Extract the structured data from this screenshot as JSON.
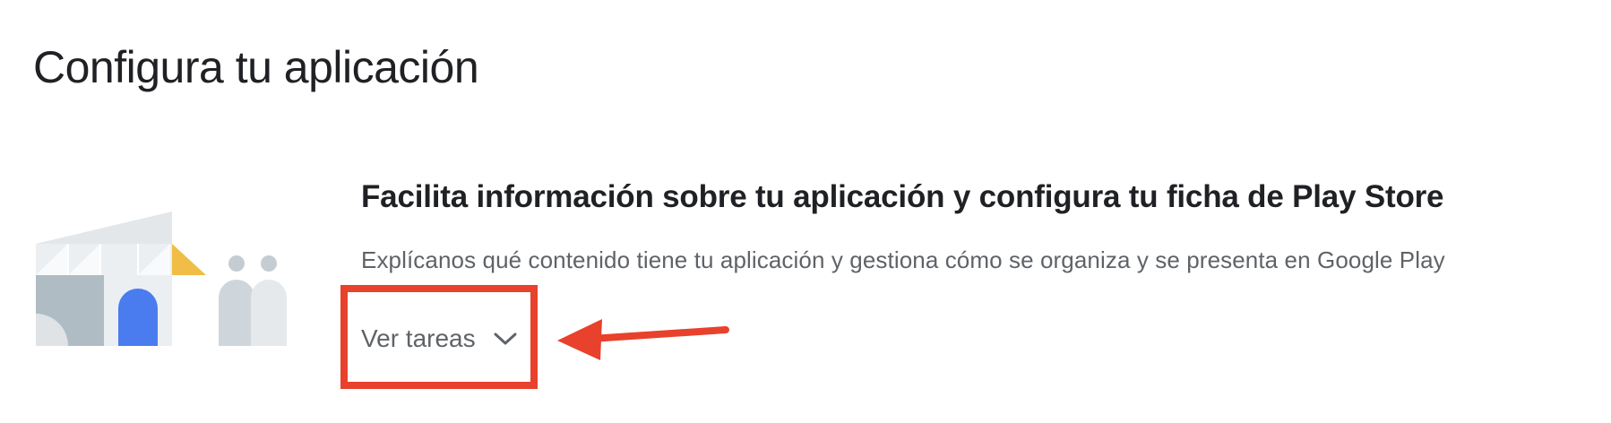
{
  "page": {
    "title": "Configura tu aplicación"
  },
  "section": {
    "title": "Facilita información sobre tu aplicación y configura tu ficha de Play Store",
    "description": "Explícanos qué contenido tiene tu aplicación y gestiona cómo se organiza y se presenta en Google Play",
    "view_tasks_label": "Ver tareas",
    "expand_icon": "chevron-down-icon"
  },
  "annotation": {
    "highlight_color": "#e8412c",
    "pointer": "arrow-pointing-left"
  },
  "colors": {
    "title_text": "#202124",
    "secondary_text": "#5f6368",
    "illustration_blue": "#4a7cf0",
    "illustration_yellow": "#f0bd46",
    "illustration_gray": "#b0bcc4"
  }
}
